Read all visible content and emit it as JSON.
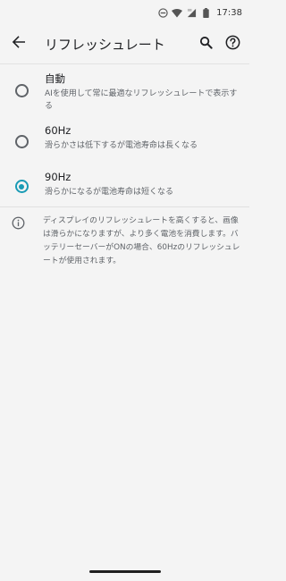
{
  "status_bar": {
    "time": "17:38",
    "icons": [
      "do-not-disturb-icon",
      "wifi-icon",
      "mobile-signal-icon",
      "battery-icon"
    ]
  },
  "app_bar": {
    "title": "リフレッシュレート",
    "back_icon": "arrow-back-icon",
    "search_icon": "search-icon",
    "help_icon": "help-icon"
  },
  "options": [
    {
      "label": "自動",
      "description": "AIを使用して常に最適なリフレッシュレートで表示する",
      "selected": false
    },
    {
      "label": "60Hz",
      "description": "滑らかさは低下するが電池寿命は長くなる",
      "selected": false
    },
    {
      "label": "90Hz",
      "description": "滑らかになるが電池寿命は短くなる",
      "selected": true
    }
  ],
  "info": {
    "icon": "info-icon",
    "text": "ディスプレイのリフレッシュレートを高くすると、画像は滑らかになりますが、より多く電池を消費します。バッテリーセーバーがONの場合、60Hzのリフレッシュレートが使用されます。"
  },
  "colors": {
    "accent": "#1a9bb5",
    "background": "#f4f4f4"
  }
}
